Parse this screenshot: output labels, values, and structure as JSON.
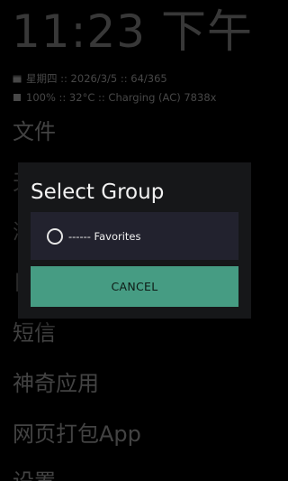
{
  "status": {
    "clock": "11:23 下午",
    "date_line": "星期四 :: 2026/3/5 :: 64/365",
    "battery_line": "100% :: 32°C :: Charging (AC) 7838x"
  },
  "app_list": {
    "items": [
      {
        "label": "文件"
      },
      {
        "label": "天"
      },
      {
        "label": "浏"
      },
      {
        "label": "日"
      },
      {
        "label": "短信"
      },
      {
        "label": "神奇应用"
      },
      {
        "label": "网页打包App"
      },
      {
        "label": "设置"
      }
    ]
  },
  "dialog": {
    "title": "Select Group",
    "options": [
      {
        "label": "------ Favorites",
        "selected": false
      }
    ],
    "cancel_label": "CANCEL"
  },
  "colors": {
    "accent": "#469c83",
    "dialog_bg": "#161719",
    "option_bg": "#22222e"
  },
  "icons": {
    "date_icon": "calendar-icon",
    "battery_icon": "battery-icon"
  }
}
